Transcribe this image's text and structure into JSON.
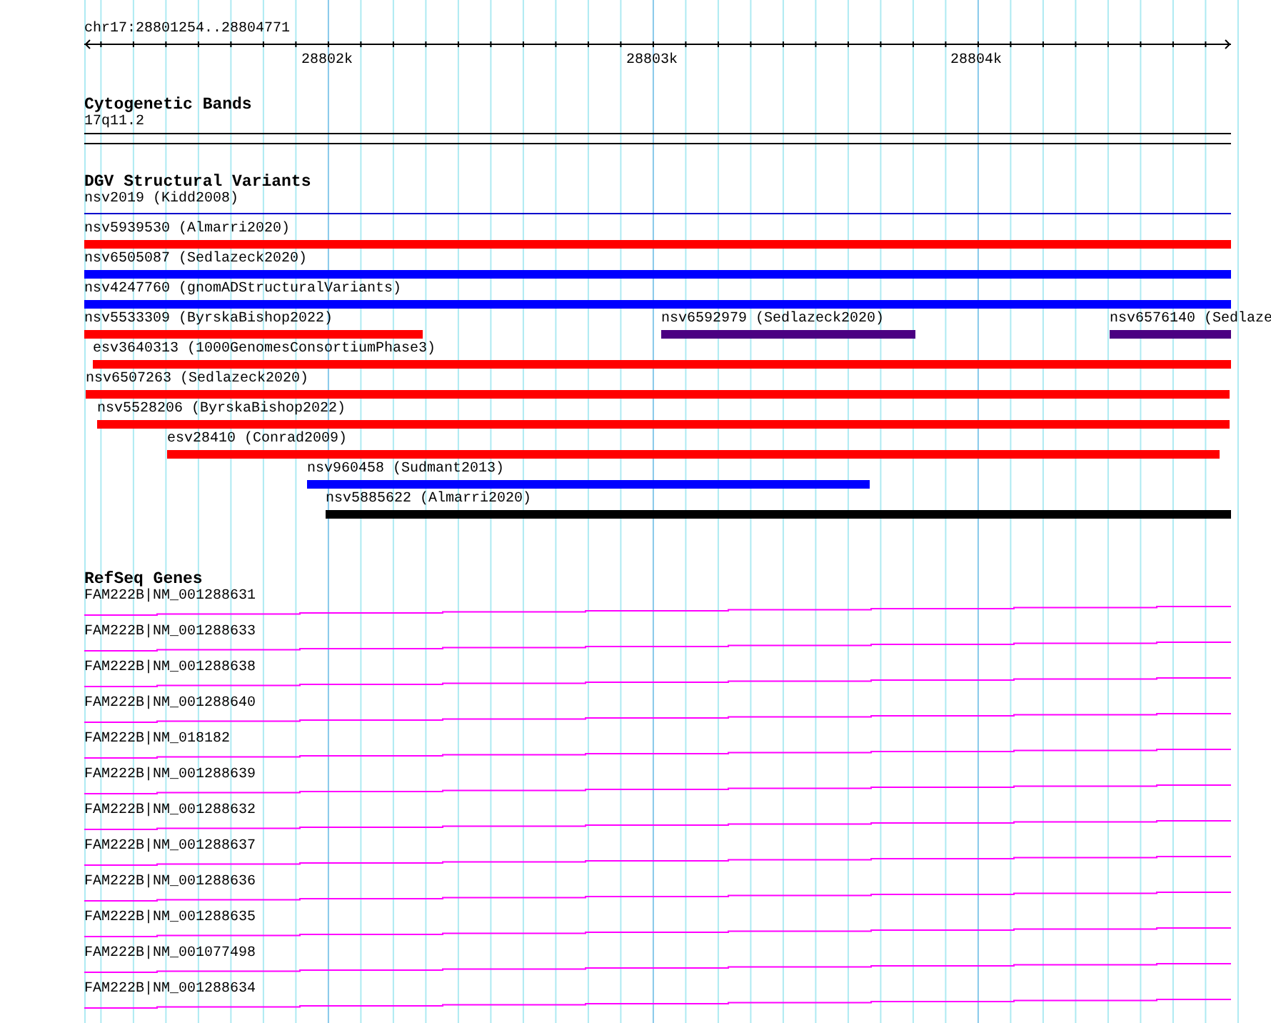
{
  "ruler": {
    "location": "chr17:28801254..28804771",
    "ticks": [
      "28802k",
      "28803k",
      "28804k"
    ]
  },
  "cytogenetic_bands": {
    "title": "Cytogenetic Bands",
    "band": "17q11.2"
  },
  "dgv_structural_variants": {
    "title": "DGV Structural Variants",
    "header_feature": {
      "label": "nsv2019 (Kidd2008)",
      "color": "#0000cc"
    },
    "rows": [
      {
        "features": [
          {
            "label": "nsv5939530 (Almarri2020)",
            "color": "#ff0000"
          }
        ]
      },
      {
        "features": [
          {
            "label": "nsv6505087 (Sedlazeck2020)",
            "color": "#0000ff"
          }
        ]
      },
      {
        "features": [
          {
            "label": "nsv4247760 (gnomADStructuralVariants)",
            "color": "#0000ff"
          }
        ]
      },
      {
        "features": [
          {
            "label": "nsv5533309 (ByrskaBishop2022)",
            "color": "#ff0000"
          },
          {
            "label": "nsv6592979 (Sedlazeck2020)",
            "color": "#4b0082"
          },
          {
            "label": "nsv6576140 (Sedlaze",
            "color": "#4b0082"
          }
        ]
      },
      {
        "features": [
          {
            "label": "esv3640313 (1000GenomesConsortiumPhase3)",
            "color": "#ff0000"
          }
        ]
      },
      {
        "features": [
          {
            "label": "nsv6507263 (Sedlazeck2020)",
            "color": "#ff0000"
          }
        ]
      },
      {
        "features": [
          {
            "label": "nsv5528206 (ByrskaBishop2022)",
            "color": "#ff0000"
          }
        ]
      },
      {
        "features": [
          {
            "label": "esv28410 (Conrad2009)",
            "color": "#ff0000"
          }
        ]
      },
      {
        "features": [
          {
            "label": "nsv960458 (Sudmant2013)",
            "color": "#0000ff"
          }
        ]
      },
      {
        "features": [
          {
            "label": "nsv5885622 (Almarri2020)",
            "color": "#000000"
          }
        ]
      }
    ]
  },
  "refseq_genes": {
    "title": "RefSeq Genes",
    "genes": [
      {
        "label": "FAM222B|NM_001288631"
      },
      {
        "label": "FAM222B|NM_001288633"
      },
      {
        "label": "FAM222B|NM_001288638"
      },
      {
        "label": "FAM222B|NM_001288640"
      },
      {
        "label": "FAM222B|NM_018182"
      },
      {
        "label": "FAM222B|NM_001288639"
      },
      {
        "label": "FAM222B|NM_001288632"
      },
      {
        "label": "FAM222B|NM_001288637"
      },
      {
        "label": "FAM222B|NM_001288636"
      },
      {
        "label": "FAM222B|NM_001288635"
      },
      {
        "label": "FAM222B|NM_001077498"
      },
      {
        "label": "FAM222B|NM_001288634"
      }
    ]
  }
}
